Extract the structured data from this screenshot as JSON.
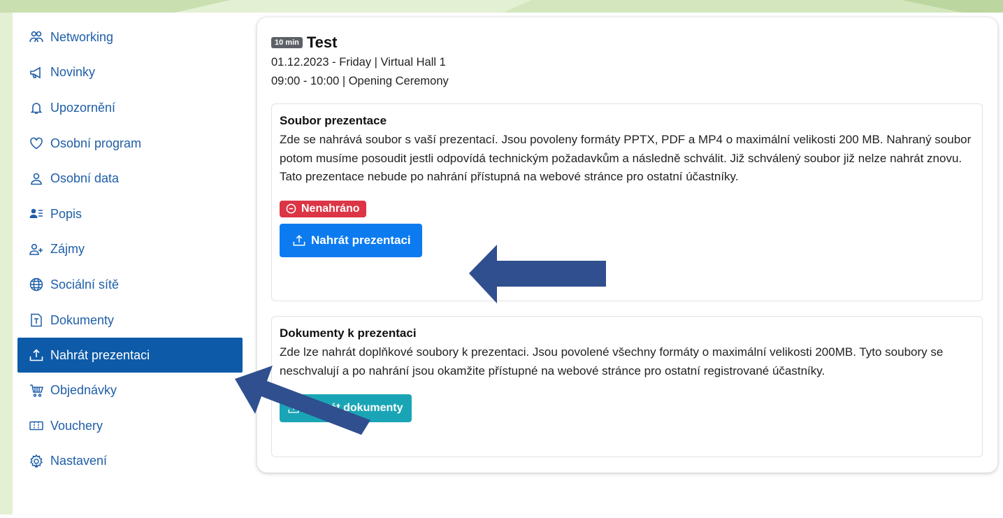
{
  "sidebar": {
    "items": [
      {
        "label": "Networking",
        "icon": "people-icon"
      },
      {
        "label": "Novinky",
        "icon": "megaphone-icon"
      },
      {
        "label": "Upozornění",
        "icon": "bell-icon"
      },
      {
        "label": "Osobní program",
        "icon": "heart-icon"
      },
      {
        "label": "Osobní data",
        "icon": "person-icon"
      },
      {
        "label": "Popis",
        "icon": "person-lines-icon"
      },
      {
        "label": "Zájmy",
        "icon": "person-plus-icon"
      },
      {
        "label": "Sociální sítě",
        "icon": "globe-icon"
      },
      {
        "label": "Dokumenty",
        "icon": "document-icon"
      },
      {
        "label": "Nahrát prezentaci",
        "icon": "upload-icon",
        "active": true
      },
      {
        "label": "Objednávky",
        "icon": "cart-icon"
      },
      {
        "label": "Vouchery",
        "icon": "ticket-icon"
      },
      {
        "label": "Nastavení",
        "icon": "gear-icon"
      }
    ]
  },
  "session": {
    "duration_badge": "10 min",
    "title": "Test",
    "date_line": "01.12.2023 - Friday | Virtual Hall 1",
    "time_line": "09:00 - 10:00 | Opening Ceremony"
  },
  "presentation": {
    "heading": "Soubor prezentace",
    "description": "Zde se nahrává soubor s vaší prezentací. Jsou povoleny formáty PPTX, PDF a MP4 o maximální velikosti 200 MB. Nahraný soubor potom musíme posoudit jestli odpovídá technickým požadavkům a následně schválit. Již schválený soubor již nelze nahrát znovu. Tato prezentace nebude po nahrání přístupná na webové stránce pro ostatní účastníky.",
    "status": "Nenahráno",
    "button": "Nahrát prezentaci"
  },
  "documents": {
    "heading": "Dokumenty k prezentaci",
    "description": "Zde lze nahrát doplňkové soubory k prezentaci. Jsou povolené všechny formáty o maximální velikosti 200MB. Tyto soubory se neschvalují a po nahrání jsou okamžite přístupné na webové stránce pro ostatní registrované účastníky.",
    "button": "Nahrát dokumenty"
  },
  "colors": {
    "accent": "#0d5ba8",
    "link": "#1f5ea8",
    "primary_button": "#0d7bf0",
    "info_button": "#1aa5b6",
    "danger": "#dc3545",
    "annotation_arrow": "#2f4f8f",
    "background_green": "#dfeecd"
  }
}
